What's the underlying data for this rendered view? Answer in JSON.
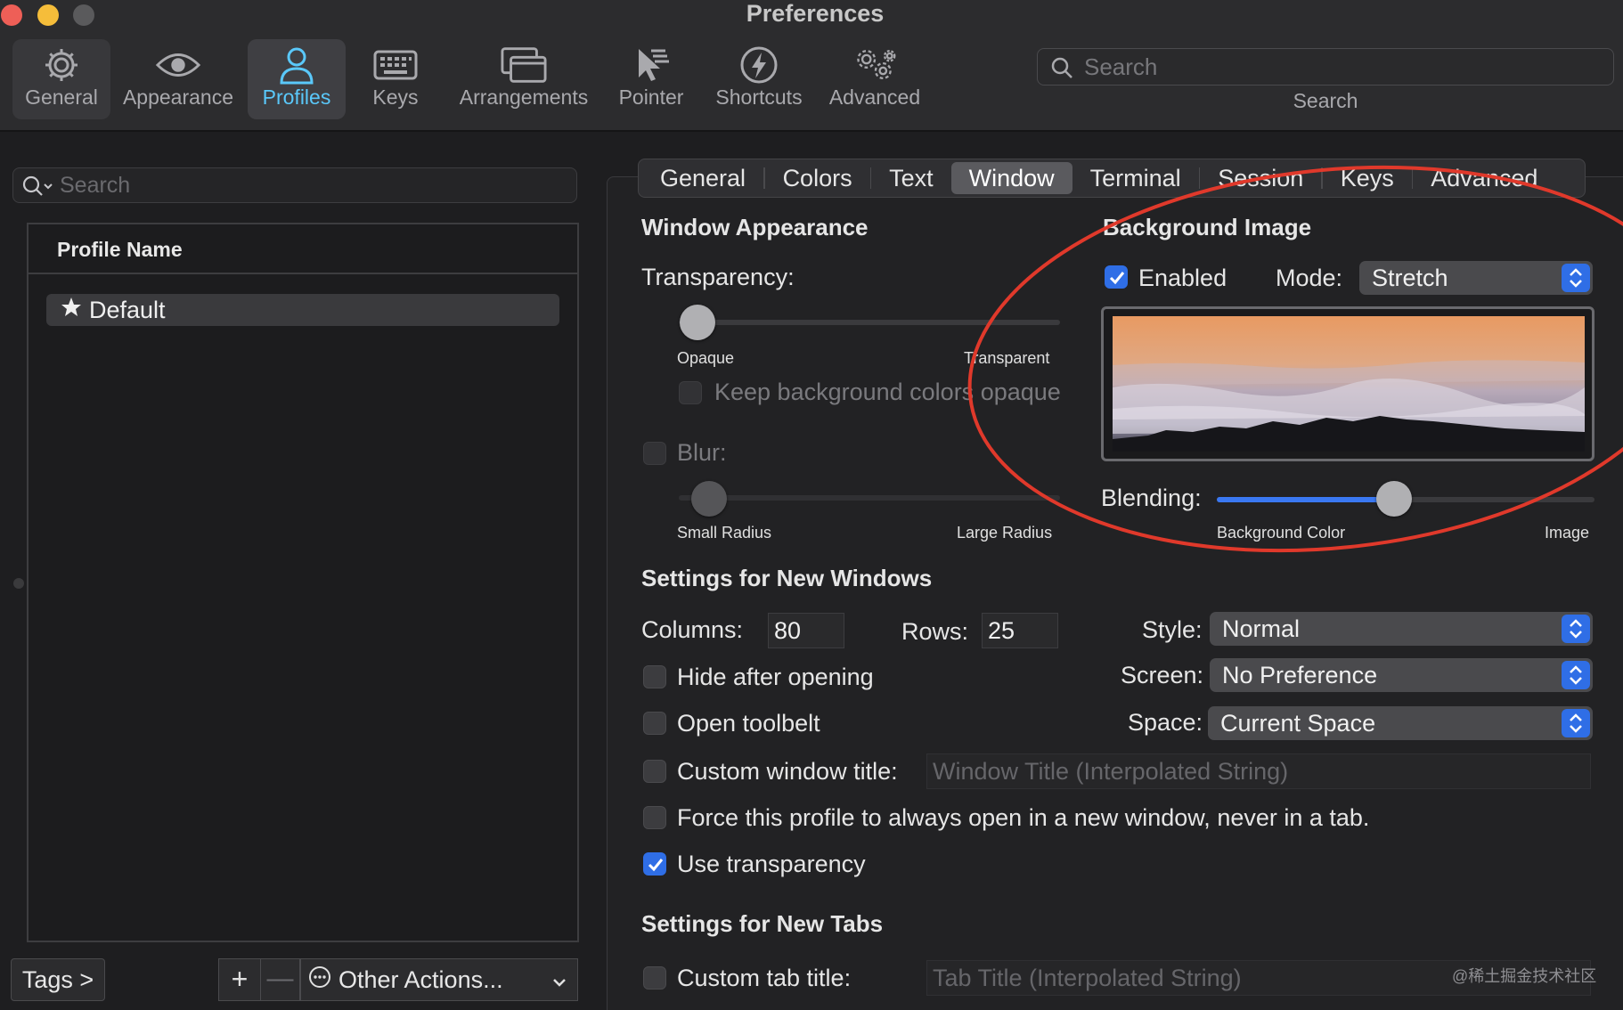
{
  "window": {
    "title": "Preferences"
  },
  "toolbar": {
    "items": [
      {
        "label": "General",
        "icon": "gear-icon"
      },
      {
        "label": "Appearance",
        "icon": "eye-icon"
      },
      {
        "label": "Profiles",
        "icon": "person-icon"
      },
      {
        "label": "Keys",
        "icon": "keyboard-icon"
      },
      {
        "label": "Arrangements",
        "icon": "windows-icon"
      },
      {
        "label": "Pointer",
        "icon": "pointer-icon"
      },
      {
        "label": "Shortcuts",
        "icon": "bolt-icon"
      },
      {
        "label": "Advanced",
        "icon": "gears-icon"
      }
    ],
    "active": "Profiles",
    "search_placeholder": "Search",
    "search_label": "Search"
  },
  "profiles": {
    "search_placeholder": "Search",
    "column_header": "Profile Name",
    "rows": [
      {
        "name": "Default",
        "icon": "star-icon"
      }
    ],
    "tags_button": "Tags >",
    "add_button": "+",
    "remove_button": "—",
    "other_actions": "Other Actions..."
  },
  "tabs": [
    {
      "label": "General"
    },
    {
      "label": "Colors"
    },
    {
      "label": "Text"
    },
    {
      "label": "Window"
    },
    {
      "label": "Terminal"
    },
    {
      "label": "Session"
    },
    {
      "label": "Keys"
    },
    {
      "label": "Advanced"
    }
  ],
  "active_tab": "Window",
  "window_appearance": {
    "title": "Window Appearance",
    "transparency_label": "Transparency:",
    "transparency_value": 0.05,
    "opaque_label": "Opaque",
    "transparent_label": "Transparent",
    "keep_bg_opaque": "Keep background colors opaque",
    "blur_label": "Blur:",
    "blur_value": 0.08,
    "small_radius": "Small Radius",
    "large_radius": "Large Radius"
  },
  "background_image": {
    "title": "Background Image",
    "enabled_label": "Enabled",
    "enabled": true,
    "mode_label": "Mode:",
    "mode_value": "Stretch",
    "blending_label": "Blending:",
    "blending_value": 0.47,
    "bg_color_label": "Background Color",
    "image_label": "Image"
  },
  "new_windows": {
    "title": "Settings for New Windows",
    "columns_label": "Columns:",
    "columns_value": "80",
    "rows_label": "Rows:",
    "rows_value": "25",
    "style_label": "Style:",
    "style_value": "Normal",
    "screen_label": "Screen:",
    "screen_value": "No Preference",
    "space_label": "Space:",
    "space_value": "Current Space",
    "hide_after_opening": "Hide after opening",
    "open_toolbelt": "Open toolbelt",
    "custom_window_title": "Custom window title:",
    "window_title_placeholder": "Window Title (Interpolated String)",
    "force_new_window": "Force this profile to always open in a new window, never in a tab.",
    "use_transparency": "Use transparency",
    "use_transparency_checked": true
  },
  "new_tabs": {
    "title": "Settings for New Tabs",
    "custom_tab_title": "Custom tab title:",
    "tab_title_placeholder": "Tab Title (Interpolated String)"
  },
  "watermark": "@稀土掘金技术社区",
  "colors": {
    "accent": "#2f6ee6",
    "active_tab_text": "#5ac8fa",
    "annotation": "#e0392b"
  }
}
